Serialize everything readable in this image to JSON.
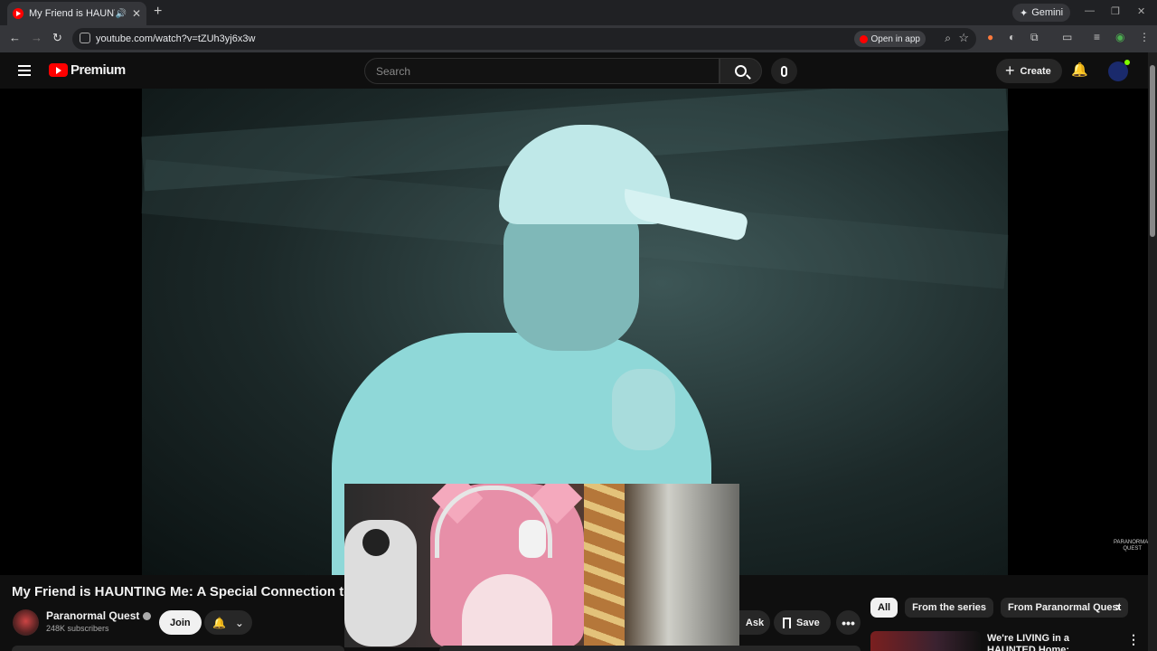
{
  "browser": {
    "tab_title": "My Friend is HAUNTING Me",
    "new_tab": "+",
    "gemini_label": "Gemini",
    "url": "youtube.com/watch?v=tZUh3yj6x3w",
    "open_in_app": "Open in app"
  },
  "header": {
    "logo_text": "Premium",
    "search_placeholder": "Search",
    "create_label": "Create"
  },
  "video": {
    "title": "My Friend is HAUNTING Me: A Special Connection to a G",
    "watermark": "PARANORMAL QUEST"
  },
  "channel": {
    "name": "Paranormal Quest",
    "subscribers": "248K subscribers",
    "join_label": "Join"
  },
  "actions": {
    "ask_label": "Ask",
    "save_label": "Save",
    "more": "•••"
  },
  "chips": [
    "All",
    "From the series",
    "From Paranormal Quest"
  ],
  "recommendation": {
    "title": "We're LIVING in a HAUNTED Home: Paranormal Activity"
  },
  "colors": {
    "accent": "#ff0000",
    "background": "#0f0f0f",
    "night_vision": "#8fd8d8"
  }
}
